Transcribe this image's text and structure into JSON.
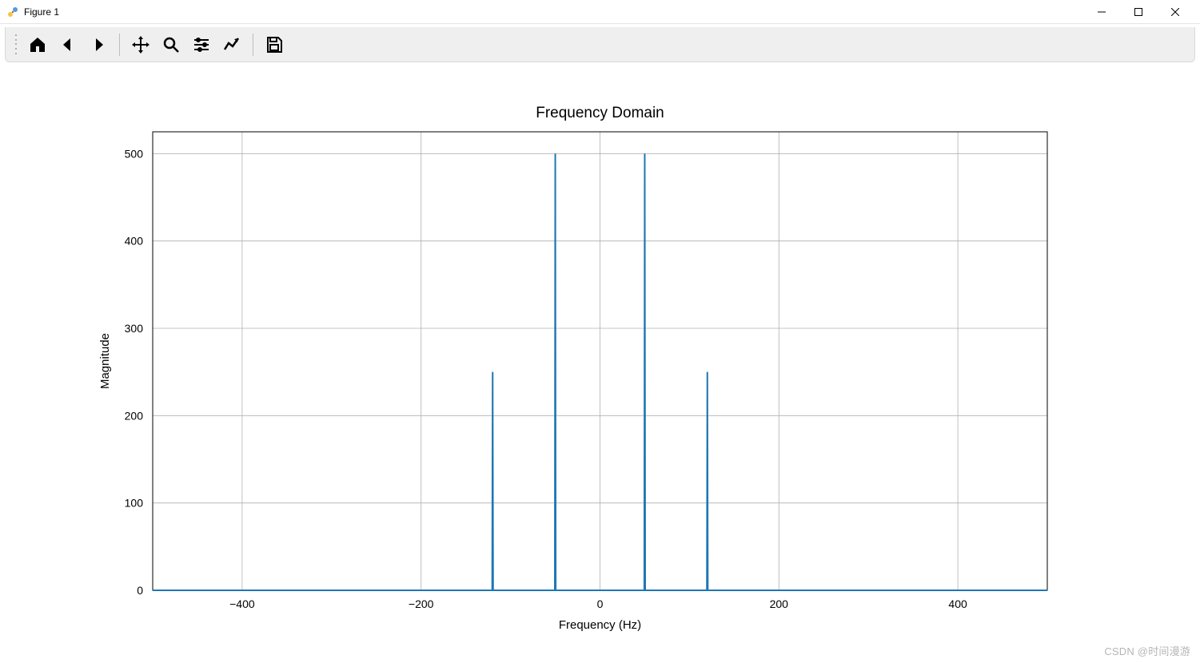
{
  "window": {
    "title": "Figure 1"
  },
  "toolbar": {
    "home": "Home",
    "back": "Back",
    "forward": "Forward",
    "pan": "Pan",
    "zoom": "Zoom",
    "subplots": "Configure subplots",
    "edit": "Edit axis",
    "save": "Save"
  },
  "watermark": "CSDN @时间漫游",
  "chart_data": {
    "type": "line",
    "title": "Frequency Domain",
    "xlabel": "Frequency (Hz)",
    "ylabel": "Magnitude",
    "xlim": [
      -500,
      500
    ],
    "ylim": [
      0,
      525
    ],
    "xticks": [
      -400,
      -200,
      0,
      200,
      400
    ],
    "yticks": [
      0,
      100,
      200,
      300,
      400,
      500
    ],
    "grid": true,
    "line_color": "#1f77b4",
    "peaks": [
      {
        "x": -120,
        "y": 250
      },
      {
        "x": -50,
        "y": 500
      },
      {
        "x": 50,
        "y": 500
      },
      {
        "x": 120,
        "y": 250
      }
    ],
    "baseline": 0
  }
}
